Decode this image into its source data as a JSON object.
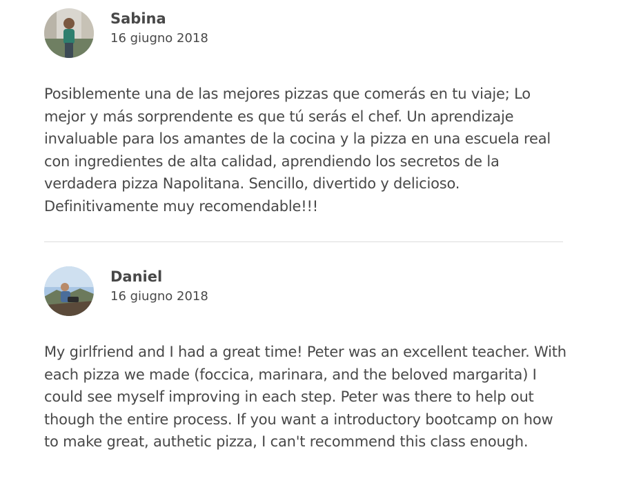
{
  "reviews": [
    {
      "name": "Sabina",
      "date": "16 giugno 2018",
      "avatar_icon": "person-photo-avatar",
      "text": "Posiblemente una de las mejores pizzas que comerás en tu viaje; Lo mejor y más sorprendente es que tú serás el chef. Un aprendizaje invaluable para los amantes de la cocina y la pizza en una escuela real con ingredientes de alta calidad, aprendiendo los secretos de la verdadera pizza Napolitana. Sencillo, divertido y delicioso. Definitivamente muy recomendable!!!"
    },
    {
      "name": "Daniel",
      "date": "16 giugno 2018",
      "avatar_icon": "person-photo-avatar",
      "text": "My girlfriend and I had a great time! Peter was an excellent teacher. With each pizza we made (foccica, marinara, and the beloved margarita) I could see myself improving in each step. Peter was there to help out though the entire process. If you want a introductory bootcamp on how to make great, authetic pizza, I can't recommend this class enough."
    }
  ],
  "colors": {
    "text": "#484848",
    "divider": "#dcdcdc"
  }
}
